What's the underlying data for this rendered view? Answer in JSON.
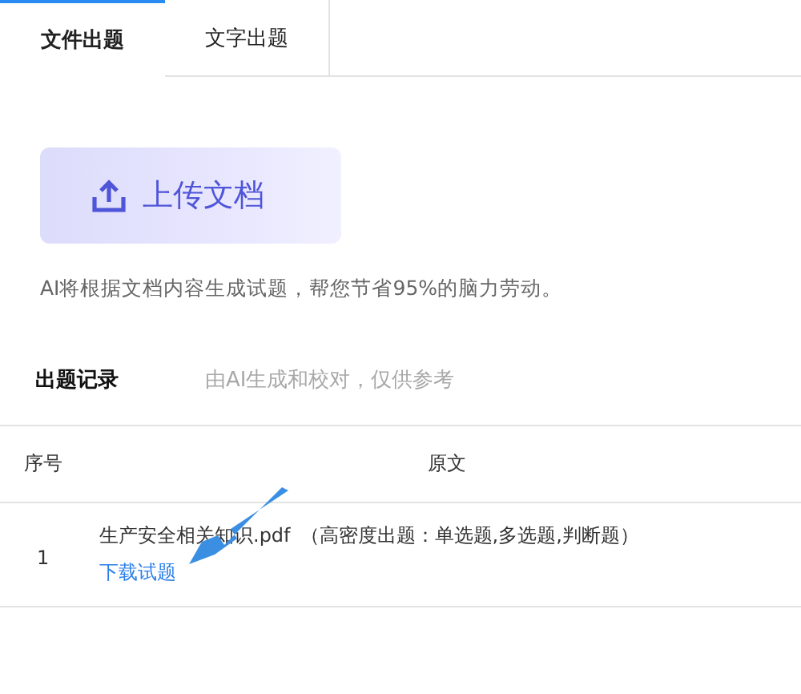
{
  "tabs": [
    {
      "label": "文件出题",
      "selected": true
    },
    {
      "label": "文字出题",
      "selected": false
    }
  ],
  "upload_button": {
    "label": "上传文档"
  },
  "description": "AI将根据文档内容生成试题，帮您节省95%的脑力劳动。",
  "records": {
    "title": "出题记录",
    "subtitle": "由AI生成和校对，仅供参考",
    "table": {
      "columns": [
        "序号",
        "原文"
      ],
      "rows": [
        {
          "index": "1",
          "file": "生产安全相关知识.pdf",
          "mode": "（高密度出题：单选题,多选题,判断题）",
          "link": "下载试题"
        }
      ]
    }
  }
}
